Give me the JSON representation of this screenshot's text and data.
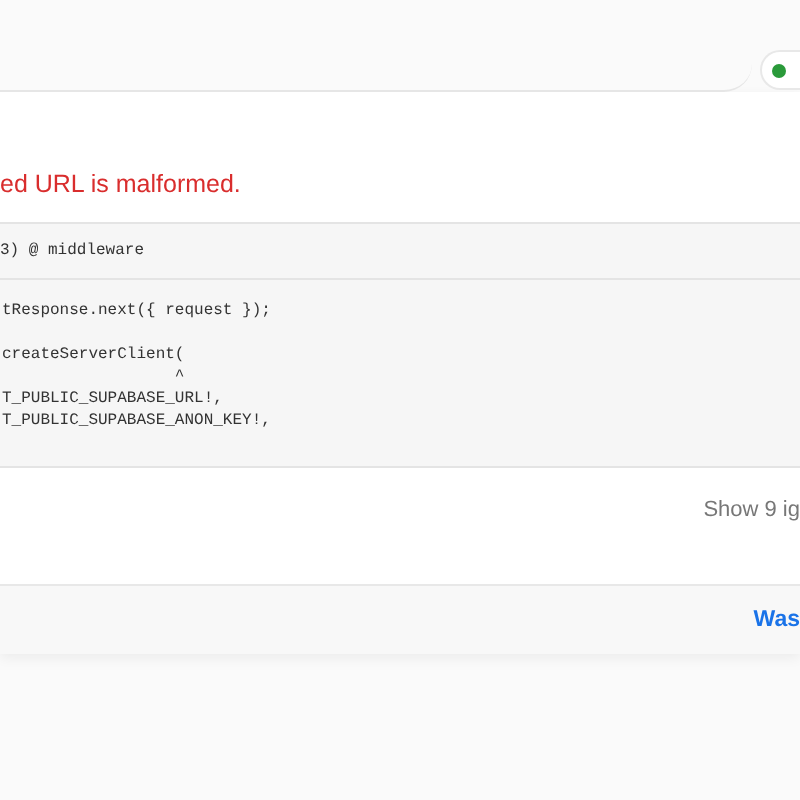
{
  "error_message": "ed URL is malformed.",
  "code_frame": {
    "location": "3) @ middleware",
    "line_groups": [
      [
        "tResponse.next({ request });"
      ],
      [
        "createServerClient(",
        "                  ^",
        "T_PUBLIC_SUPABASE_URL!,",
        "T_PUBLIC_SUPABASE_ANON_KEY!,"
      ]
    ]
  },
  "ignored_frames_toggle": "Show 9 ig",
  "footer": {
    "link": "Was"
  }
}
